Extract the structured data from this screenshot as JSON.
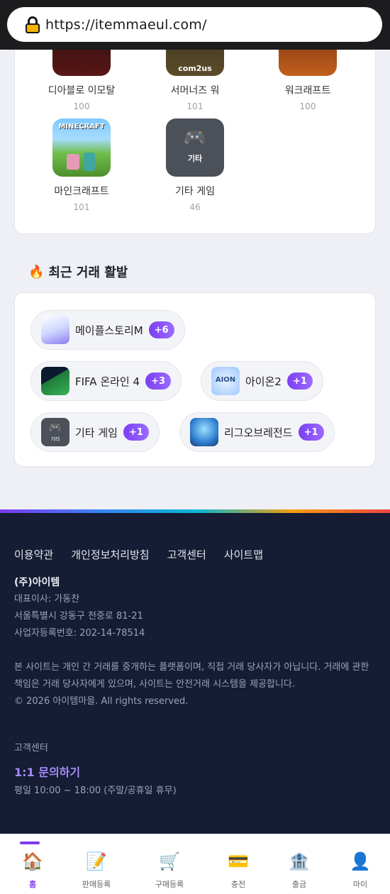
{
  "browser": {
    "url": "https://itemmaeul.com/"
  },
  "games": [
    {
      "name": "디아블로 이모탈",
      "count": "100",
      "icon": "diablo-immortal-icon"
    },
    {
      "name": "서머너즈 워",
      "count": "101",
      "icon": "summoners-war-icon",
      "logo_text": "com2us"
    },
    {
      "name": "워크래프트",
      "count": "100",
      "icon": "warcraft-icon"
    },
    {
      "name": "마인크래프트",
      "count": "101",
      "icon": "minecraft-icon",
      "logo_text": "MINECRAFT"
    },
    {
      "name": "기타 게임",
      "count": "46",
      "icon": "gamepad-icon",
      "tile_text": "기타"
    }
  ],
  "hot_section": {
    "emoji": "🔥",
    "title": "최근 거래 활발",
    "items": [
      {
        "name": "메이플스토리M",
        "badge": "+6",
        "icon": "maplestory-m-icon"
      },
      {
        "name": "FIFA 온라인 4",
        "badge": "+3",
        "icon": "fifa-online-4-icon"
      },
      {
        "name": "아이온2",
        "badge": "+1",
        "icon": "aion2-icon",
        "logo_text": "AION"
      },
      {
        "name": "기타 게임",
        "badge": "+1",
        "icon": "gamepad-icon",
        "tile_text": "기타"
      },
      {
        "name": "리그오브레전드",
        "badge": "+1",
        "icon": "league-of-legends-icon"
      }
    ]
  },
  "footer": {
    "links": [
      "이용약관",
      "개인정보처리방침",
      "고객센터",
      "사이트맵"
    ],
    "company_name": "(주)아이템",
    "ceo": "대표이사: 가동찬",
    "address": "서울특별시 강동구 천중로 81-21",
    "business_number": "사업자등록번호: 202-14-78514",
    "notice": "본 사이트는 개인 간 거래를 중개하는 플랫폼이며, 직접 거래 당사자가 아닙니다. 거래에 관한 책임은 거래 당사자에게 있으며, 사이트는 안전거래 시스템을 제공합니다.",
    "copyright": "© 2026 아이템마을. All rights reserved.",
    "cs_label": "고객센터",
    "cs_link": "1:1 문의하기",
    "cs_hours": "평일 10:00 ~ 18:00 (주말/공휴일 휴무)"
  },
  "bottom_nav": [
    {
      "label": "홈",
      "icon": "home-icon",
      "glyph": "🏠",
      "active": true
    },
    {
      "label": "판매등록",
      "icon": "memo-icon",
      "glyph": "📝",
      "active": false
    },
    {
      "label": "구매등록",
      "icon": "cart-icon",
      "glyph": "🛒",
      "active": false
    },
    {
      "label": "충전",
      "icon": "credit-card-icon",
      "glyph": "💳",
      "active": false
    },
    {
      "label": "출금",
      "icon": "bank-icon",
      "glyph": "🏦",
      "active": false
    },
    {
      "label": "마이",
      "icon": "user-icon",
      "glyph": "👤",
      "active": false
    }
  ]
}
